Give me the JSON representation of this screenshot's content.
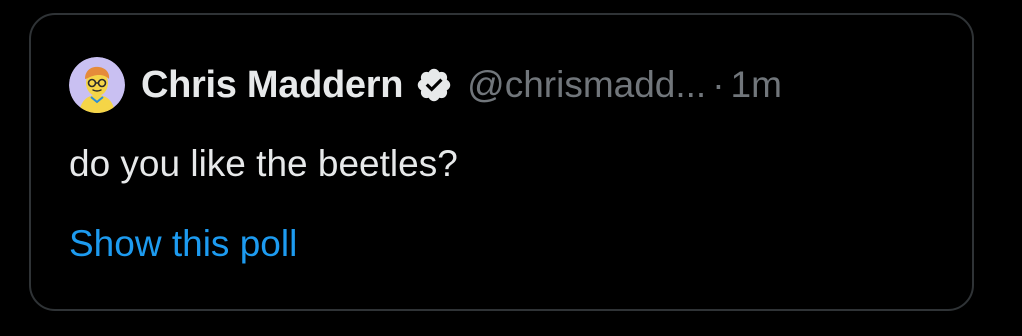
{
  "tweet": {
    "author": {
      "display_name": "Chris Maddern",
      "handle": "@chrismadd...",
      "avatar_icon": "avatar-illustration",
      "verified_icon": "verified-badge-icon"
    },
    "separator": "·",
    "timestamp": "1m",
    "text": "do you like the beetles?",
    "poll_link": "Show this poll"
  },
  "colors": {
    "background": "#000000",
    "border": "#2f3336",
    "text_primary": "#e7e9ea",
    "text_secondary": "#71767b",
    "link": "#1d9bf0",
    "avatar_bg": "#c9c0f2"
  }
}
